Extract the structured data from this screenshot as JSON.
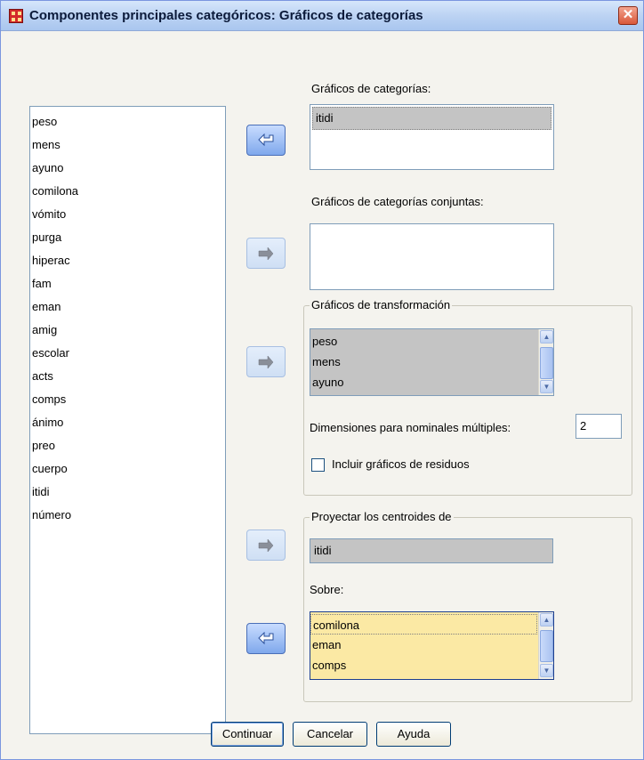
{
  "window": {
    "title": "Componentes principales categóricos: Gráficos de categorías",
    "close_glyph": "✕"
  },
  "source_list": {
    "items": [
      "peso",
      "mens",
      "ayuno",
      "comilona",
      "vómito",
      "purga",
      "hiperac",
      "fam",
      "eman",
      "amig",
      "escolar",
      "acts",
      "comps",
      "ánimo",
      "preo",
      "cuerpo",
      "itidi",
      "número"
    ]
  },
  "category_plots": {
    "label": "Gráficos de categorías:",
    "items": [
      "itidi"
    ]
  },
  "joint_category_plots": {
    "label": "Gráficos de categorías conjuntas:",
    "items": []
  },
  "transformation_plots": {
    "legend": "Gráficos de transformación",
    "items": [
      "peso",
      "mens",
      "ayuno"
    ],
    "dimensions_label": "Dimensiones para nominales múltiples:",
    "dimensions_value": "2",
    "residuals_label": "Incluir gráficos de residuos",
    "residuals_checked": false
  },
  "project_centroids": {
    "legend": "Proyectar los centroides de",
    "value": "itidi",
    "onto_label": "Sobre:",
    "onto_items": [
      "comilona",
      "eman",
      "comps"
    ]
  },
  "buttons": {
    "continue": "Continuar",
    "cancel": "Cancelar",
    "help": "Ayuda"
  },
  "icons": {
    "arrow_left": "arrow-left-icon",
    "arrow_right": "arrow-right-icon"
  },
  "colors": {
    "selection_gray": "#c4c4c4",
    "highlight_yellow": "#fbe9a4",
    "arrow_active": "#7fa8ec"
  }
}
